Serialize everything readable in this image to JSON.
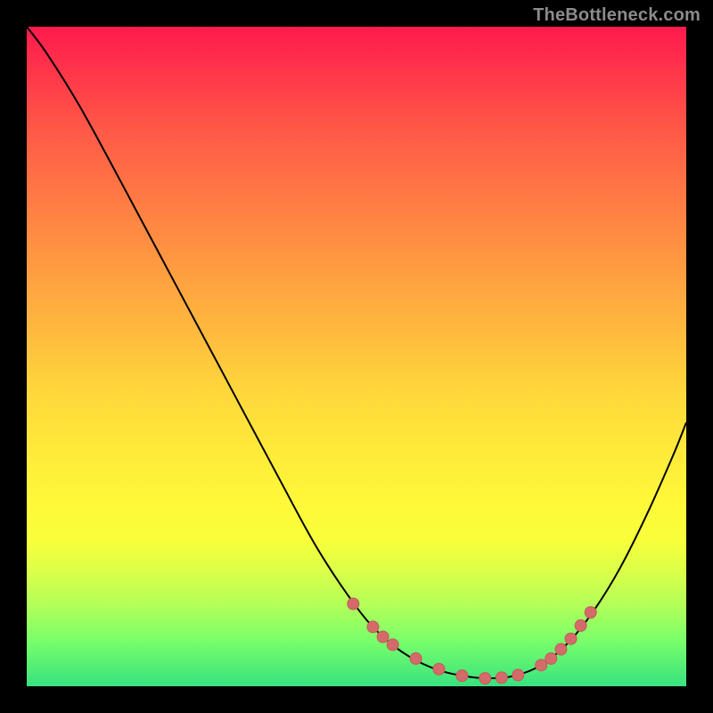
{
  "watermark": "TheBottleneck.com",
  "colors": {
    "curve": "#000000",
    "marker_fill": "#d46a6a",
    "marker_stroke": "#c55a5a"
  },
  "chart_data": {
    "type": "line",
    "title": "",
    "xlabel": "",
    "ylabel": "",
    "xlim": [
      0,
      100
    ],
    "ylim": [
      0,
      100
    ],
    "grid": false,
    "legend": false,
    "series": [
      {
        "name": "curve",
        "x": [
          0,
          3,
          8,
          14,
          22,
          30,
          38,
          44,
          50,
          54,
          58,
          62,
          66,
          70,
          74,
          78,
          82,
          86,
          90,
          94,
          98,
          100
        ],
        "y": [
          100,
          96,
          88,
          77,
          62,
          47,
          32,
          21,
          12,
          7.5,
          4.5,
          2.6,
          1.6,
          1.2,
          1.6,
          3.2,
          6.5,
          11.5,
          18,
          26,
          35,
          40
        ]
      }
    ],
    "markers": {
      "name": "highlight-points",
      "x": [
        49.5,
        52.5,
        54,
        55.5,
        59,
        62.5,
        66,
        69.5,
        72,
        74.5,
        78,
        79.5,
        81,
        82.5,
        84,
        85.5
      ],
      "y": [
        12.5,
        9,
        7.5,
        6.3,
        4.2,
        2.6,
        1.6,
        1.2,
        1.3,
        1.7,
        3.2,
        4.2,
        5.6,
        7.2,
        9.2,
        11.2
      ]
    }
  }
}
